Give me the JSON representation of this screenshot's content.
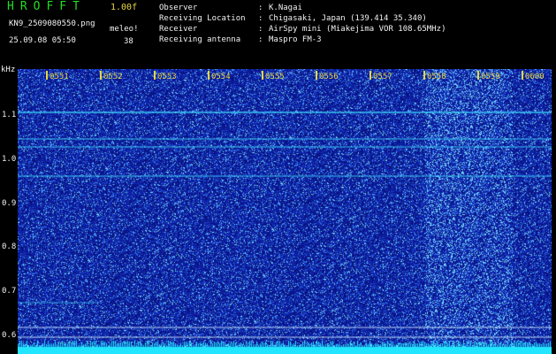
{
  "header": {
    "title": "HROFFT",
    "version": "1.00f",
    "file_name": "KN9_2509080550.png",
    "meteor_label": "meleo!",
    "meteor_count": "38",
    "date_time": "25.09.08 05:50"
  },
  "info": [
    {
      "label": "Observer",
      "sep": ":",
      "value": "K.Nagai"
    },
    {
      "label": "Receiving Location",
      "sep": ":",
      "value": "Chigasaki, Japan (139.414 35.340)"
    },
    {
      "label": "Receiver",
      "sep": ":",
      "value": "AirSpy mini (Miakejima VOR 108.65MHz)"
    },
    {
      "label": "Receiving antenna",
      "sep": ":",
      "value": "Maspro FM-3"
    }
  ],
  "axis": {
    "y_unit": "kHz",
    "y_ticks": [
      "1.1",
      "1.0",
      "0.9",
      "0.8",
      "0.7",
      "0.6"
    ],
    "x_ticks": [
      "0551",
      "0552",
      "0553",
      "0554",
      "0555",
      "0556",
      "0557",
      "0558",
      "0559",
      "0600"
    ]
  },
  "colors": {
    "background": "#000000",
    "spectrogram_base": "#0a14a0",
    "signal_line": "#40e0ff",
    "tick_yellow": "#e8d640",
    "title_green": "#22dd22"
  }
}
